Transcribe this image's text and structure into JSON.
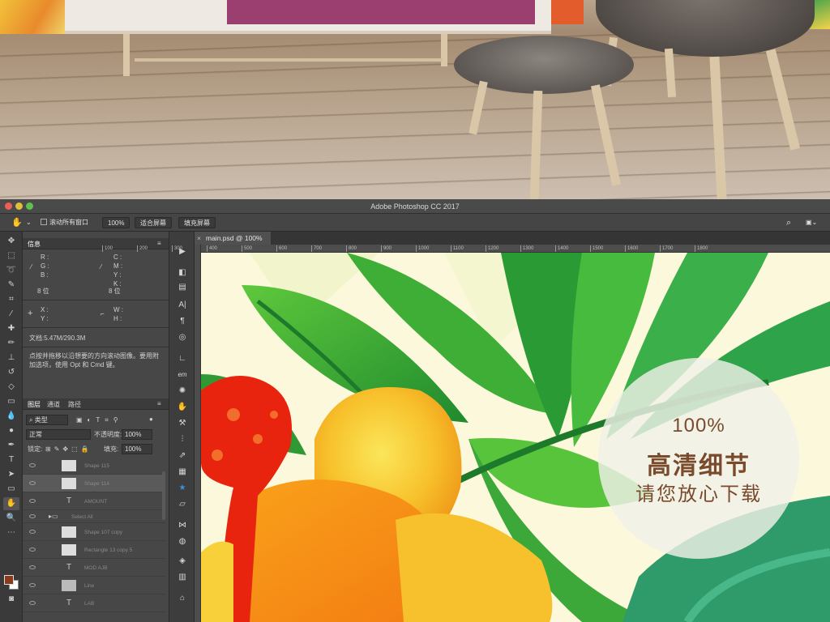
{
  "window": {
    "title": "Adobe Photoshop CC 2017"
  },
  "options_bar": {
    "scroll_all_label": "滚动所有窗口",
    "zoom_100": "100%",
    "fit_screen": "适合屏幕",
    "fill_screen": "填充屏幕"
  },
  "info_panel": {
    "tab": "信息",
    "rgb": [
      "R :",
      "G :",
      "B :"
    ],
    "cmyk": [
      "C :",
      "M :",
      "Y :",
      "K :"
    ],
    "bits_left": "8 位",
    "bits_right": "8 位",
    "xy": [
      "X :",
      "Y :"
    ],
    "wh": [
      "W :",
      "H :"
    ],
    "doc_size": "文档:5.47M/290.3M",
    "hint_line1": "点按并拖移以沿想要的方向滚动图像。要用附",
    "hint_line2": "加选项，使用 Opt 和 Cmd 键。"
  },
  "layers_panel": {
    "tabs": [
      "图层",
      "通道",
      "路径"
    ],
    "filter_kind": "类型",
    "blend_mode": "正常",
    "opacity_label": "不透明度:",
    "opacity_value": "100%",
    "lock_label": "锁定:",
    "fill_label": "填充:",
    "fill_value": "100%",
    "layers": [
      {
        "name": "Shape 115",
        "kind": "shape"
      },
      {
        "name": "Shape 114",
        "kind": "shape"
      },
      {
        "name": "AMOUNT",
        "kind": "text"
      },
      {
        "name": "Select All",
        "kind": "group"
      },
      {
        "name": "Shape 107 copy",
        "kind": "shape"
      },
      {
        "name": "Rectangle 13 copy 5",
        "kind": "shape"
      },
      {
        "name": "MOD AJB",
        "kind": "text"
      },
      {
        "name": "Line",
        "kind": "shape"
      },
      {
        "name": "LAB",
        "kind": "text"
      }
    ]
  },
  "document": {
    "tab": "main.psd @ 100%",
    "ruler_ticks": [
      "100",
      "200",
      "300",
      "400",
      "500",
      "600",
      "700",
      "800",
      "900",
      "1000",
      "1100",
      "1200",
      "1300",
      "1400",
      "1500",
      "1600",
      "1700",
      "1800"
    ]
  },
  "badge": {
    "line1": "100%",
    "line2": "高清细节",
    "line3": "请您放心下载"
  },
  "colors": {
    "foreground": "#8a3b1e",
    "background": "#ffffff",
    "badge_text": "#7a4a2c"
  }
}
